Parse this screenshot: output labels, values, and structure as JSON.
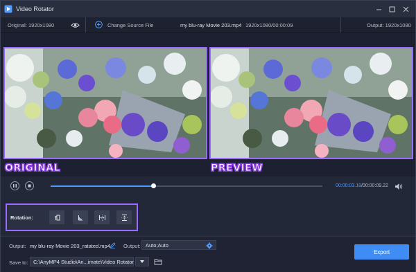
{
  "window": {
    "title": "Video Rotator"
  },
  "infobar": {
    "original": "Original: 1920x1080",
    "change_source": "Change Source File",
    "file_name": "my blu-ray Movie 203.mp4",
    "file_meta": "1920x1080/00:00:09",
    "output": "Output: 1920x1080"
  },
  "panels": {
    "original_label": "ORIGINAL",
    "preview_label": "PREVIEW"
  },
  "player": {
    "current_time": "00:00:03.18",
    "total_time": "/00:00:09.22",
    "progress": 0.378
  },
  "rotation": {
    "label": "Rotation:"
  },
  "bottom": {
    "output_label": "Output:",
    "output_file": "my blu-ray Movie 203_ratated.mp4",
    "format_label": "Output:",
    "format_value": "Auto;Auto",
    "saveto_label": "Save to:",
    "saveto_path": "C:\\AnyMP4 Studio\\An...imate\\Video Rotator",
    "export_label": "Export"
  },
  "colors": {
    "accent": "#3f8cf5",
    "highlight": "#9b6bff",
    "background": "#232838"
  },
  "icons": [
    "app-icon",
    "minimize-icon",
    "maximize-icon",
    "close-icon",
    "eye-icon",
    "add-circle-icon",
    "pause-icon",
    "stop-icon",
    "volume-icon",
    "rotate-left-icon",
    "rotate-right-icon",
    "flip-horizontal-icon",
    "flip-vertical-icon",
    "edit-icon",
    "gear-icon",
    "chevron-down-icon",
    "folder-icon"
  ]
}
